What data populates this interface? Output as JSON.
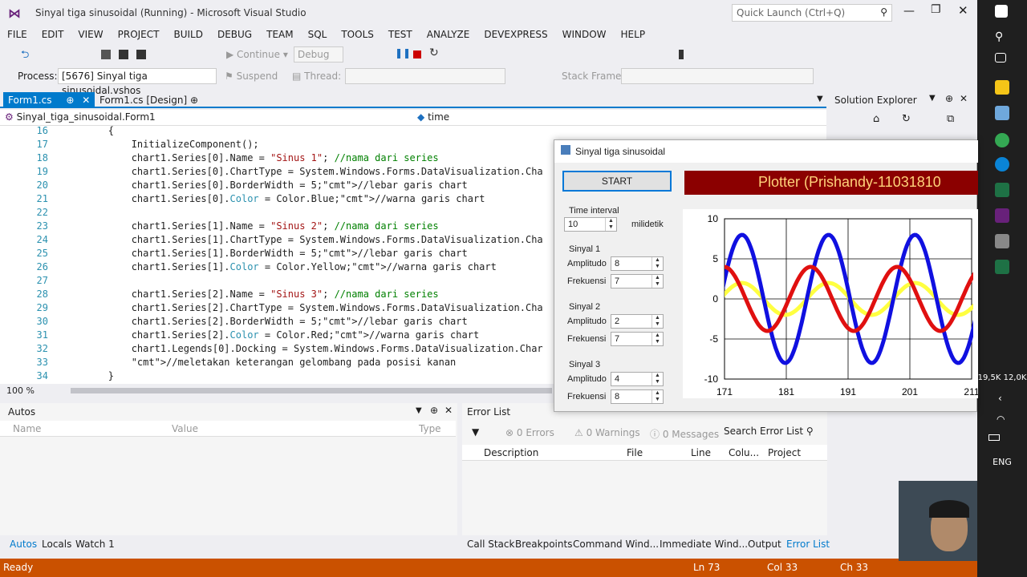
{
  "window": {
    "title": "Sinyal tiga sinusoidal (Running) - Microsoft Visual Studio",
    "quick_launch": "Quick Launch (Ctrl+Q)"
  },
  "menu": [
    "FILE",
    "EDIT",
    "VIEW",
    "PROJECT",
    "BUILD",
    "DEBUG",
    "TEAM",
    "SQL",
    "TOOLS",
    "TEST",
    "ANALYZE",
    "DEVEXPRESS",
    "WINDOW",
    "HELP"
  ],
  "toolbar": {
    "continue": "Continue",
    "config": "Debug",
    "process_label": "Process:",
    "process_value": "[5676] Sinyal tiga sinusoidal.vshos",
    "suspend": "Suspend",
    "thread_label": "Thread:",
    "stack_label": "Stack Frame:"
  },
  "tabs": {
    "active": "Form1.cs",
    "second": "Form1.cs [Design]"
  },
  "navbar": {
    "class": "Sinyal_tiga_sinusoidal.Form1",
    "member": "time"
  },
  "solution_explorer": {
    "title": "Solution Explorer"
  },
  "code_lines": [
    {
      "n": "16",
      "t": "        {"
    },
    {
      "n": "17",
      "t": "            InitializeComponent();"
    },
    {
      "n": "18",
      "t": "            chart1.Series[0].Name = \"Sinus 1\"; //nama dari series"
    },
    {
      "n": "19",
      "t": "            chart1.Series[0].ChartType = System.Windows.Forms.DataVisualization.Cha"
    },
    {
      "n": "20",
      "t": "            chart1.Series[0].BorderWidth = 5;//lebar garis chart"
    },
    {
      "n": "21",
      "t": "            chart1.Series[0].Color = Color.Blue;//warna garis chart"
    },
    {
      "n": "22",
      "t": ""
    },
    {
      "n": "23",
      "t": "            chart1.Series[1].Name = \"Sinus 2\"; //nama dari series"
    },
    {
      "n": "24",
      "t": "            chart1.Series[1].ChartType = System.Windows.Forms.DataVisualization.Cha"
    },
    {
      "n": "25",
      "t": "            chart1.Series[1].BorderWidth = 5;//lebar garis chart"
    },
    {
      "n": "26",
      "t": "            chart1.Series[1].Color = Color.Yellow;//warna garis chart"
    },
    {
      "n": "27",
      "t": ""
    },
    {
      "n": "28",
      "t": "            chart1.Series[2].Name = \"Sinus 3\"; //nama dari series"
    },
    {
      "n": "29",
      "t": "            chart1.Series[2].ChartType = System.Windows.Forms.DataVisualization.Cha"
    },
    {
      "n": "30",
      "t": "            chart1.Series[2].BorderWidth = 5;//lebar garis chart"
    },
    {
      "n": "31",
      "t": "            chart1.Series[2].Color = Color.Red;//warna garis chart"
    },
    {
      "n": "32",
      "t": "            chart1.Legends[0].Docking = System.Windows.Forms.DataVisualization.Char"
    },
    {
      "n": "33",
      "t": "            //meletakan keterangan gelombang pada posisi kanan"
    },
    {
      "n": "34",
      "t": "        }"
    }
  ],
  "zoom": "100 %",
  "autos": {
    "title": "Autos",
    "col_name": "Name",
    "col_value": "Value",
    "col_type": "Type"
  },
  "error_list": {
    "title": "Error List",
    "errors": "0 Errors",
    "warnings": "0 Warnings",
    "messages": "0 Messages",
    "search": "Search Error List",
    "cols": [
      "Description",
      "File",
      "Line",
      "Colu...",
      "Project"
    ]
  },
  "bottom_tabs": {
    "left": [
      "Autos",
      "Locals",
      "Watch 1"
    ],
    "right": [
      "Call Stack",
      "Breakpoints",
      "Command Wind...",
      "Immediate Wind...",
      "Output",
      "Error List"
    ]
  },
  "status": {
    "ready": "Ready",
    "ln": "Ln 73",
    "col": "Col 33",
    "ch": "Ch 33"
  },
  "taskbar": {
    "net": "19,5K 12,0K",
    "lang": "ENG"
  },
  "form": {
    "title": "Sinyal tiga sinusoidal",
    "start": "START",
    "banner": "Plotter (Prishandy-11031810",
    "time_interval_label": "Time interval",
    "time_interval_value": "10",
    "time_unit": "milidetik",
    "signals": [
      {
        "label": "Sinyal 1",
        "amp_label": "Amplitudo",
        "amp": "8",
        "freq_label": "Frekuensi",
        "freq": "7"
      },
      {
        "label": "Sinyal 2",
        "amp_label": "Amplitudo",
        "amp": "2",
        "freq_label": "Frekuensi",
        "freq": "7"
      },
      {
        "label": "Sinyal 3",
        "amp_label": "Amplitudo",
        "amp": "4",
        "freq_label": "Frekuensi",
        "freq": "8"
      }
    ]
  },
  "chart_data": {
    "type": "line",
    "x_ticks": [
      "171",
      "181",
      "191",
      "201",
      "211"
    ],
    "y_ticks": [
      "10",
      "5",
      "0",
      "-5",
      "-10"
    ],
    "xlim": [
      171,
      211
    ],
    "ylim": [
      -10,
      10
    ],
    "grid": true,
    "series": [
      {
        "color": "#1010e0",
        "amplitude": 8,
        "period": 14,
        "phase": 0.3
      },
      {
        "color": "#ffff40",
        "amplitude": 2,
        "period": 14,
        "phase": 0.3
      },
      {
        "color": "#e01010",
        "amplitude": 4,
        "period": 14,
        "phase": 1.6
      }
    ]
  }
}
